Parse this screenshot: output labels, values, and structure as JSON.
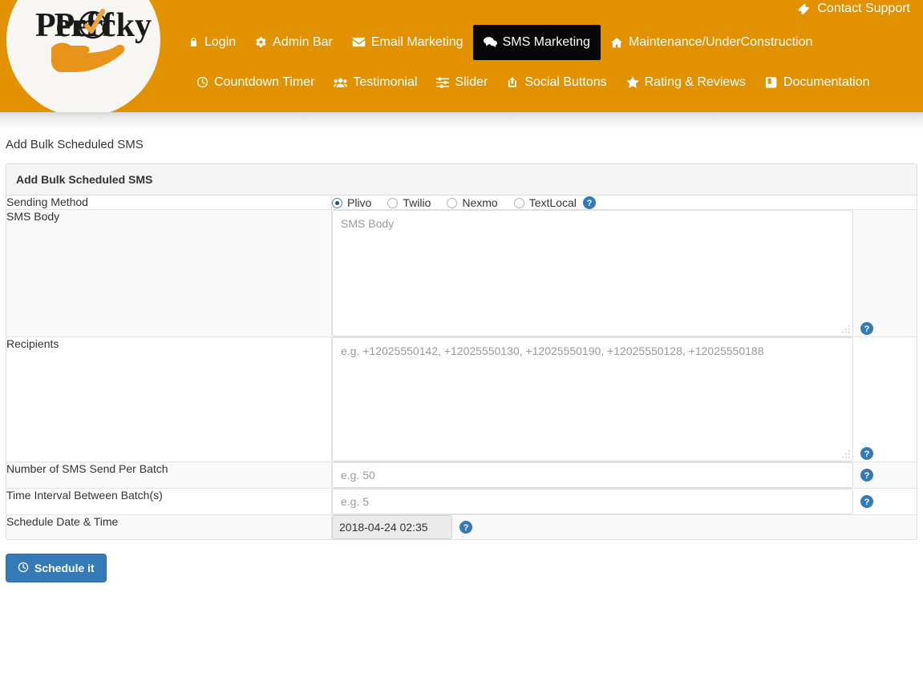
{
  "header": {
    "brand": "Perfecky",
    "background_color": "#e29100",
    "active_color": "#080808",
    "contact_support": {
      "label": "Contact Support",
      "icon": "ticket-icon"
    },
    "nav_row1": [
      {
        "label": "Login",
        "icon": "lock-icon",
        "active": false
      },
      {
        "label": "Admin Bar",
        "icon": "gear-icon",
        "active": false
      },
      {
        "label": "Email Marketing",
        "icon": "envelope-icon",
        "active": false
      },
      {
        "label": "SMS Marketing",
        "icon": "comments-icon",
        "active": true
      },
      {
        "label": "Maintenance/UnderConstruction",
        "icon": "home-icon",
        "active": false
      }
    ],
    "nav_row2": [
      {
        "label": "Countdown Timer",
        "icon": "clock-icon",
        "active": false
      },
      {
        "label": "Testimonial",
        "icon": "users-icon",
        "active": false
      },
      {
        "label": "Slider",
        "icon": "sliders-icon",
        "active": false
      },
      {
        "label": "Social Buttons",
        "icon": "share-icon",
        "active": false
      },
      {
        "label": "Rating & Reviews",
        "icon": "star-icon",
        "active": false
      },
      {
        "label": "Documentation",
        "icon": "book-icon",
        "active": false
      }
    ]
  },
  "page": {
    "title": "Add Bulk Scheduled SMS",
    "panel_heading": "Add Bulk Scheduled SMS"
  },
  "form": {
    "sending_method": {
      "label": "Sending Method",
      "options": [
        {
          "label": "Plivo",
          "checked": true
        },
        {
          "label": "Twilio",
          "checked": false
        },
        {
          "label": "Nexmo",
          "checked": false
        },
        {
          "label": "TextLocal",
          "checked": false
        }
      ],
      "help_icon": "help-circle-icon"
    },
    "sms_body": {
      "label": "SMS Body",
      "placeholder": "SMS Body",
      "value": "",
      "help_icon": "help-circle-icon"
    },
    "recipients": {
      "label": "Recipients",
      "placeholder": "e.g. +12025550142, +12025550130, +12025550190, +12025550128, +12025550188",
      "value": "",
      "help_icon": "help-circle-icon"
    },
    "batch_size": {
      "label": "Number of SMS Send Per Batch",
      "placeholder": "e.g. 50",
      "value": "",
      "help_icon": "help-circle-icon"
    },
    "interval": {
      "label": "Time Interval Between Batch(s)",
      "placeholder": "e.g. 5",
      "value": "",
      "help_icon": "help-circle-icon"
    },
    "schedule": {
      "label": "Schedule Date & Time",
      "value": "2018-04-24 02:35",
      "help_icon": "help-circle-icon"
    },
    "submit": {
      "label": "Schedule it",
      "icon": "clock-icon",
      "color": "#337ab7"
    }
  }
}
